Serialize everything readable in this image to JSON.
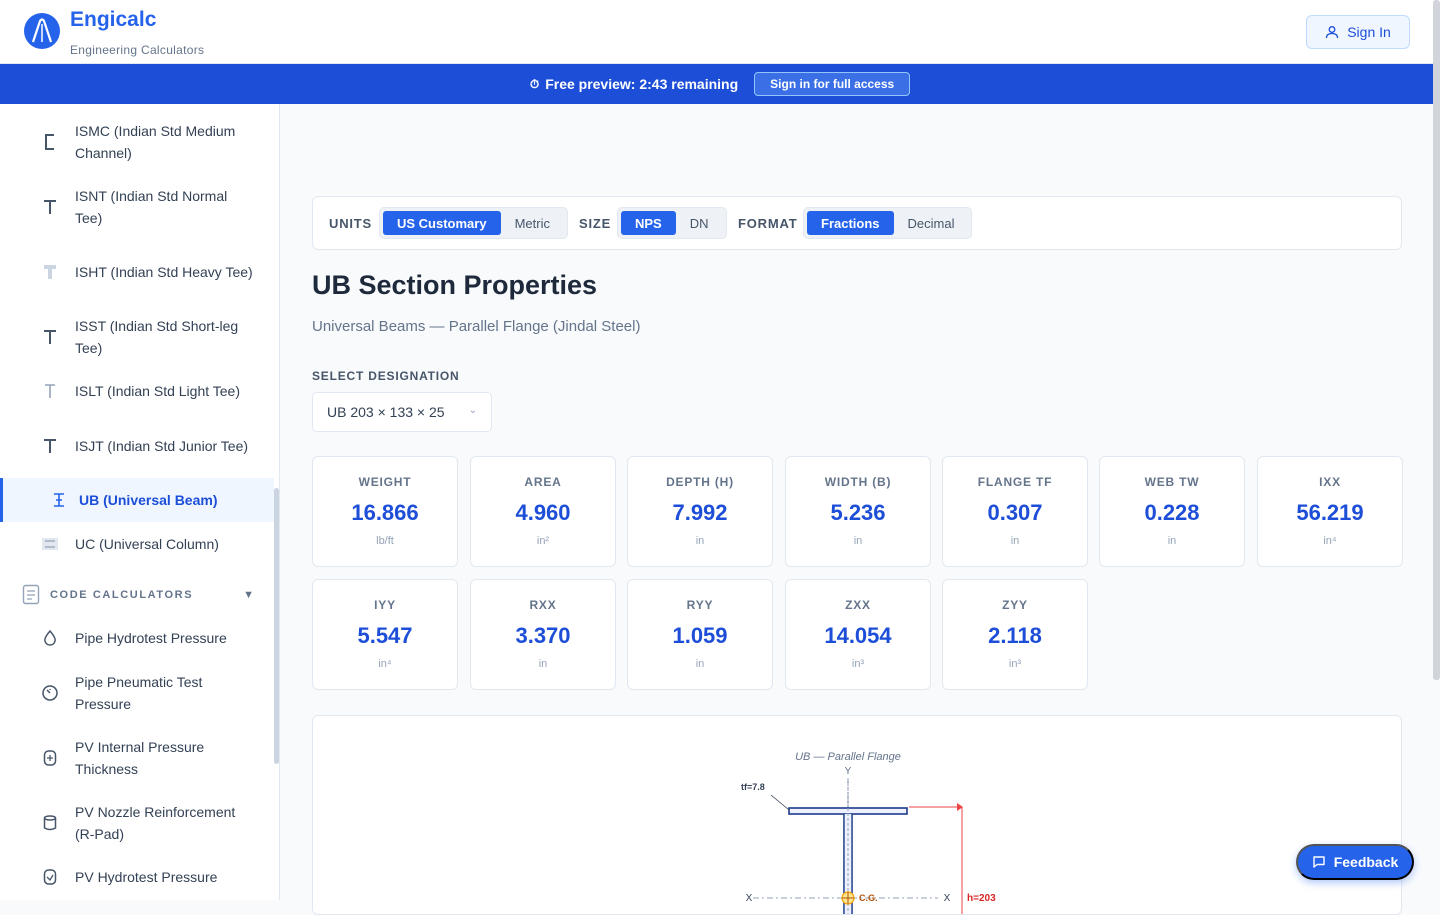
{
  "app": {
    "name": "Engicalc",
    "tagline": "Engineering Calculators",
    "sign_in": "Sign In"
  },
  "banner": {
    "icon": "stopwatch-icon",
    "text": "Free preview: 2:43 remaining",
    "button": "Sign in for full access"
  },
  "sidebar": {
    "items": [
      {
        "label": "ISMC (Indian Std Medium Channel)",
        "icon": "channel-section-icon"
      },
      {
        "label": "ISNT (Indian Std Normal Tee)",
        "icon": "tee-section-icon"
      },
      {
        "label": "ISHT (Indian Std Heavy Tee)",
        "icon": "tee-section-icon"
      },
      {
        "label": "ISST (Indian Std Short-leg Tee)",
        "icon": "tee-section-icon"
      },
      {
        "label": "ISLT (Indian Std Light Tee)",
        "icon": "tee-section-icon"
      },
      {
        "label": "ISJT (Indian Std Junior Tee)",
        "icon": "tee-section-icon"
      },
      {
        "label": "UB (Universal Beam)",
        "icon": "beam-section-icon",
        "active": true
      },
      {
        "label": "UC (Universal Column)",
        "icon": "column-section-icon"
      }
    ],
    "section": {
      "title": "CODE CALCULATORS",
      "caret": "▼",
      "icon": "document-icon"
    },
    "code_items": [
      {
        "label": "Pipe Hydrotest Pressure",
        "icon": "droplet-icon"
      },
      {
        "label": "Pipe Pneumatic Test Pressure",
        "icon": "gauge-icon"
      },
      {
        "label": "PV Internal Pressure Thickness",
        "icon": "vessel-icon"
      },
      {
        "label": "PV Nozzle Reinforcement (R-Pad)",
        "icon": "cylinder-icon"
      },
      {
        "label": "PV Hydrotest Pressure",
        "icon": "vessel-icon"
      }
    ]
  },
  "toolbar": {
    "units": {
      "label": "UNITS",
      "options": [
        "US Customary",
        "Metric"
      ],
      "selected": "US Customary"
    },
    "size": {
      "label": "SIZE",
      "options": [
        "NPS",
        "DN"
      ],
      "selected": "NPS"
    },
    "format": {
      "label": "FORMAT",
      "options": [
        "Fractions",
        "Decimal"
      ],
      "selected": "Fractions"
    }
  },
  "page": {
    "title": "UB Section Properties",
    "subtitle": "Universal Beams — Parallel Flange (Jindal Steel)",
    "select_label": "SELECT DESIGNATION",
    "designation": "UB 203 × 133 × 25"
  },
  "properties": [
    {
      "key": "WEIGHT",
      "value": "16.866",
      "unit": "lb/ft"
    },
    {
      "key": "AREA",
      "value": "4.960",
      "unit": "in²"
    },
    {
      "key": "DEPTH (H)",
      "value": "7.992",
      "unit": "in"
    },
    {
      "key": "WIDTH (B)",
      "value": "5.236",
      "unit": "in"
    },
    {
      "key": "FLANGE TF",
      "value": "0.307",
      "unit": "in"
    },
    {
      "key": "WEB TW",
      "value": "0.228",
      "unit": "in"
    },
    {
      "key": "IXX",
      "value": "56.219",
      "unit": "in⁴"
    },
    {
      "key": "IYY",
      "value": "5.547",
      "unit": "in⁴"
    },
    {
      "key": "RXX",
      "value": "3.370",
      "unit": "in"
    },
    {
      "key": "RYY",
      "value": "1.059",
      "unit": "in"
    },
    {
      "key": "ZXX",
      "value": "14.054",
      "unit": "in³"
    },
    {
      "key": "ZYY",
      "value": "2.118",
      "unit": "in³"
    }
  ],
  "diagram": {
    "caption": "UB — Parallel Flange",
    "y_axis": "Y",
    "x_axis_left": "X",
    "x_axis_right": "X",
    "tf_label": "tf=7.8",
    "cg_label": "C.G.",
    "h_label": "h=203",
    "colors": {
      "outline": "#1e3a8a",
      "dimension": "#dc2626",
      "cg": "#f59e0b"
    }
  },
  "feedback": "Feedback",
  "colors": {
    "accent": "#2563eb",
    "banner": "#1d4ed8"
  }
}
